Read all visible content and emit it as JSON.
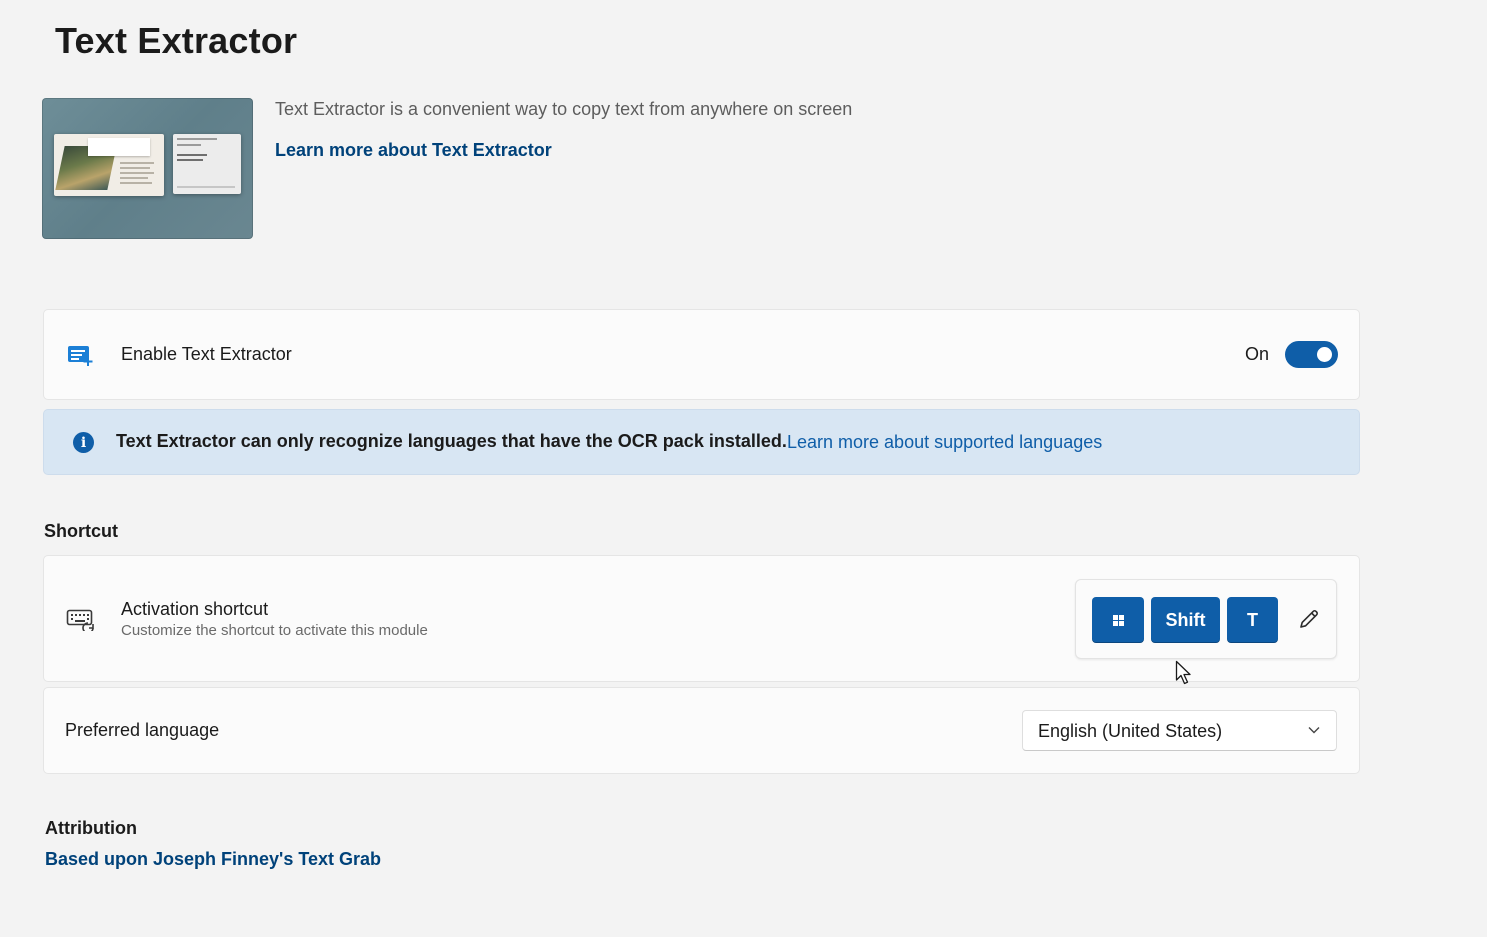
{
  "page": {
    "title": "Text Extractor"
  },
  "hero": {
    "description": "Text Extractor is a convenient way to copy text from anywhere on screen",
    "learn_more_link": "Learn more about Text Extractor",
    "image_icon": "text-extractor-preview-image"
  },
  "enable": {
    "icon": "text-extractor-icon",
    "label": "Enable Text Extractor",
    "state_label": "On",
    "enabled": true
  },
  "info_bar": {
    "icon": "info-icon",
    "glyph": "i",
    "message": "Text Extractor can only recognize languages that have the OCR pack installed.",
    "link": "Learn more about supported languages"
  },
  "shortcut_section": {
    "header": "Shortcut",
    "activation": {
      "icon": "keyboard-icon",
      "label": "Activation shortcut",
      "description": "Customize the shortcut to activate this module",
      "keys": [
        {
          "type": "windows",
          "icon": "windows-logo-icon"
        },
        {
          "type": "text",
          "label": "Shift"
        },
        {
          "type": "text",
          "label": "T"
        }
      ],
      "edit_icon": "pencil-icon"
    }
  },
  "language": {
    "label": "Preferred language",
    "selected": "English (United States)",
    "chevron_icon": "chevron-down-icon"
  },
  "attribution": {
    "header": "Attribution",
    "link": "Based upon Joseph Finney's Text Grab"
  },
  "colors": {
    "accent": "#0f5ea8",
    "link": "#00427a",
    "info_background": "#d8e6f3",
    "page_background": "#f3f3f3",
    "card_background": "#fbfbfb"
  }
}
